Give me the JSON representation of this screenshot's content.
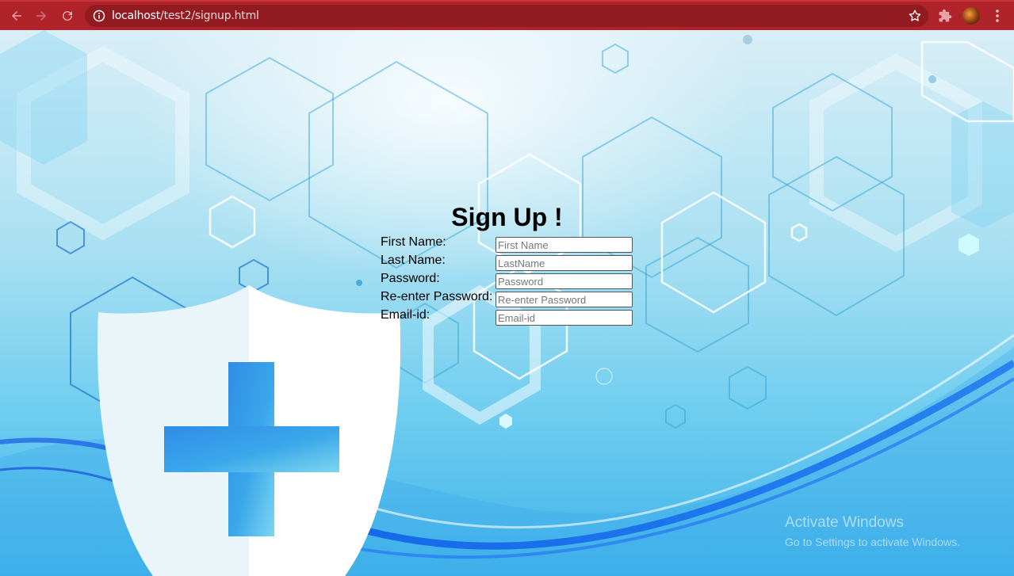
{
  "browser": {
    "url_host": "localhost",
    "url_path": "/test2/signup.html",
    "icons": {
      "back": "back-arrow-icon",
      "forward": "forward-arrow-icon",
      "reload": "reload-icon",
      "site_info": "info-icon",
      "bookmark": "star-icon",
      "extensions": "puzzle-icon",
      "profile": "avatar",
      "menu": "more-vertical-icon"
    },
    "colors": {
      "chrome": "#b0232b",
      "omnibox": "#921b22"
    }
  },
  "form": {
    "title": "Sign Up !",
    "fields": [
      {
        "label": "First Name:",
        "placeholder": "First Name",
        "value": ""
      },
      {
        "label": "Last Name:",
        "placeholder": "LastName",
        "value": ""
      },
      {
        "label": "Password:",
        "placeholder": "Password",
        "value": ""
      },
      {
        "label": "Re-enter Password:",
        "placeholder": "Re-enter Password",
        "value": ""
      },
      {
        "label": "Email-id:",
        "placeholder": "Email-id",
        "value": ""
      }
    ]
  },
  "watermark": {
    "line1": "Activate Windows",
    "line2": "Go to Settings to activate Windows."
  }
}
